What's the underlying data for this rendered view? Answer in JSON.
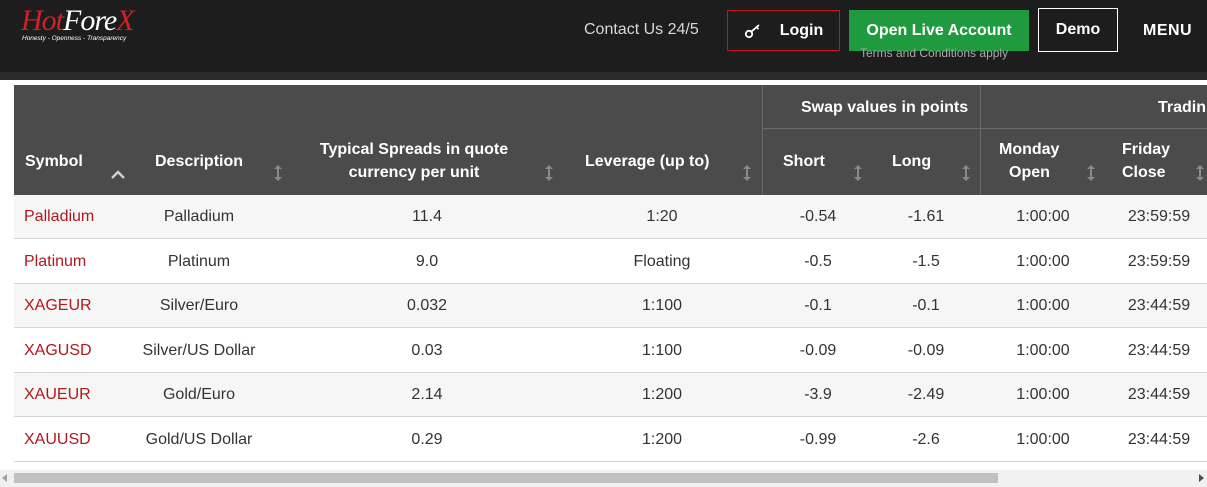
{
  "header": {
    "logo_text_1": "Hot",
    "logo_text_2": "Fore",
    "logo_text_3": "X",
    "logo_tagline": "Honesty - Openness - Transparency",
    "contact": "Contact Us 24/5",
    "login": "Login",
    "open_live": "Open Live Account",
    "terms": "Terms and Conditions apply",
    "demo": "Demo",
    "menu": "MENU"
  },
  "table": {
    "group_swap": "Swap values in points",
    "group_trading": "Tradin",
    "columns": {
      "symbol": "Symbol",
      "description": "Description",
      "spread_1": "Typical Spreads in quote",
      "spread_2": "currency per unit",
      "leverage": "Leverage (up to)",
      "short": "Short",
      "long": "Long",
      "mon_1": "Monday",
      "mon_2": "Open",
      "fri_1": "Friday",
      "fri_2": "Close"
    },
    "rows": [
      {
        "symbol": "Palladium",
        "description": "Palladium",
        "spread": "11.4",
        "leverage": "1:20",
        "short": "-0.54",
        "long": "-1.61",
        "monday_open": "1:00:00",
        "friday_close": "23:59:59"
      },
      {
        "symbol": "Platinum",
        "description": "Platinum",
        "spread": "9.0",
        "leverage": "Floating",
        "short": "-0.5",
        "long": "-1.5",
        "monday_open": "1:00:00",
        "friday_close": "23:59:59"
      },
      {
        "symbol": "XAGEUR",
        "description": "Silver/Euro",
        "spread": "0.032",
        "leverage": "1:100",
        "short": "-0.1",
        "long": "-0.1",
        "monday_open": "1:00:00",
        "friday_close": "23:44:59"
      },
      {
        "symbol": "XAGUSD",
        "description": "Silver/US Dollar",
        "spread": "0.03",
        "leverage": "1:100",
        "short": "-0.09",
        "long": "-0.09",
        "monday_open": "1:00:00",
        "friday_close": "23:44:59"
      },
      {
        "symbol": "XAUEUR",
        "description": "Gold/Euro",
        "spread": "2.14",
        "leverage": "1:200",
        "short": "-3.9",
        "long": "-2.49",
        "monday_open": "1:00:00",
        "friday_close": "23:44:59"
      },
      {
        "symbol": "XAUUSD",
        "description": "Gold/US Dollar",
        "spread": "0.29",
        "leverage": "1:200",
        "short": "-0.99",
        "long": "-2.6",
        "monday_open": "1:00:00",
        "friday_close": "23:44:59"
      }
    ]
  },
  "colors": {
    "header_bg": "#1d1d1d",
    "brand_red": "#b0181e",
    "live_green": "#1f9a3f",
    "table_head_bg": "#4b4b4b"
  },
  "icons": {
    "login": "key-icon",
    "sort_symbol": "chevron-up-icon",
    "sort_other": "sort-arrows-icon"
  }
}
